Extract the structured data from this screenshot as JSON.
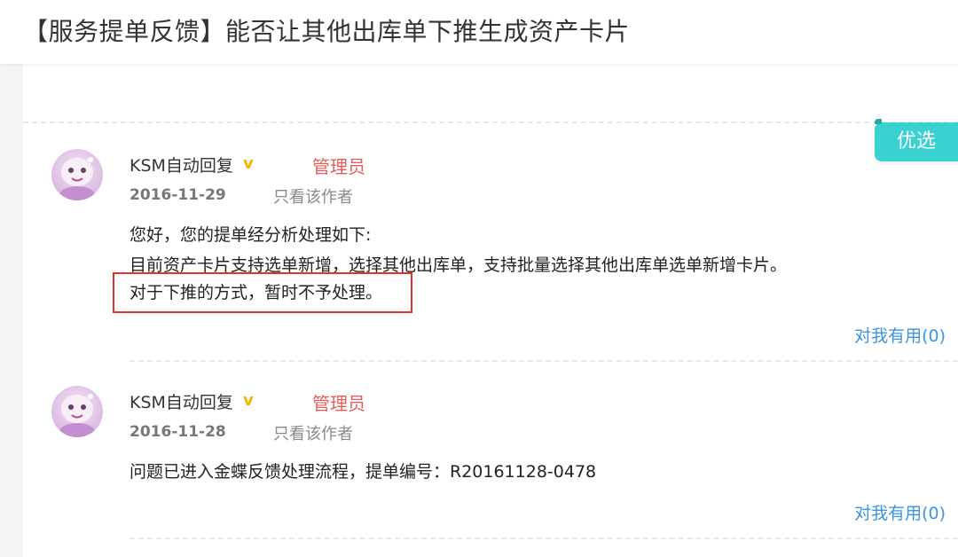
{
  "header": {
    "title": "【服务提单反馈】能否让其他出库单下推生成资产卡片"
  },
  "badge": {
    "label": "优选"
  },
  "replies": [
    {
      "author": "KSM自动回复",
      "vip_mark": "v",
      "role": "管理员",
      "date": "2016-11-29",
      "author_only": "只看该作者",
      "lines": [
        "您好，您的提单经分析处理如下:",
        "目前资产卡片支持选单新增，选择其他出库单，支持批量选择其他出库单选单新增卡片。",
        "对于下推的方式，暂时不予处理。"
      ],
      "useful": "对我有用(0)"
    },
    {
      "author": "KSM自动回复",
      "vip_mark": "v",
      "role": "管理员",
      "date": "2016-11-28",
      "author_only": "只看该作者",
      "lines": [
        "问题已进入金蝶反馈处理流程，提单编号：R20161128-0478"
      ],
      "useful": "对我有用(0)"
    }
  ],
  "colors": {
    "accent_badge": "#3ad1d3",
    "role_red": "#e85b5b",
    "link_blue": "#3b95dd",
    "highlight_red": "#e53030"
  }
}
